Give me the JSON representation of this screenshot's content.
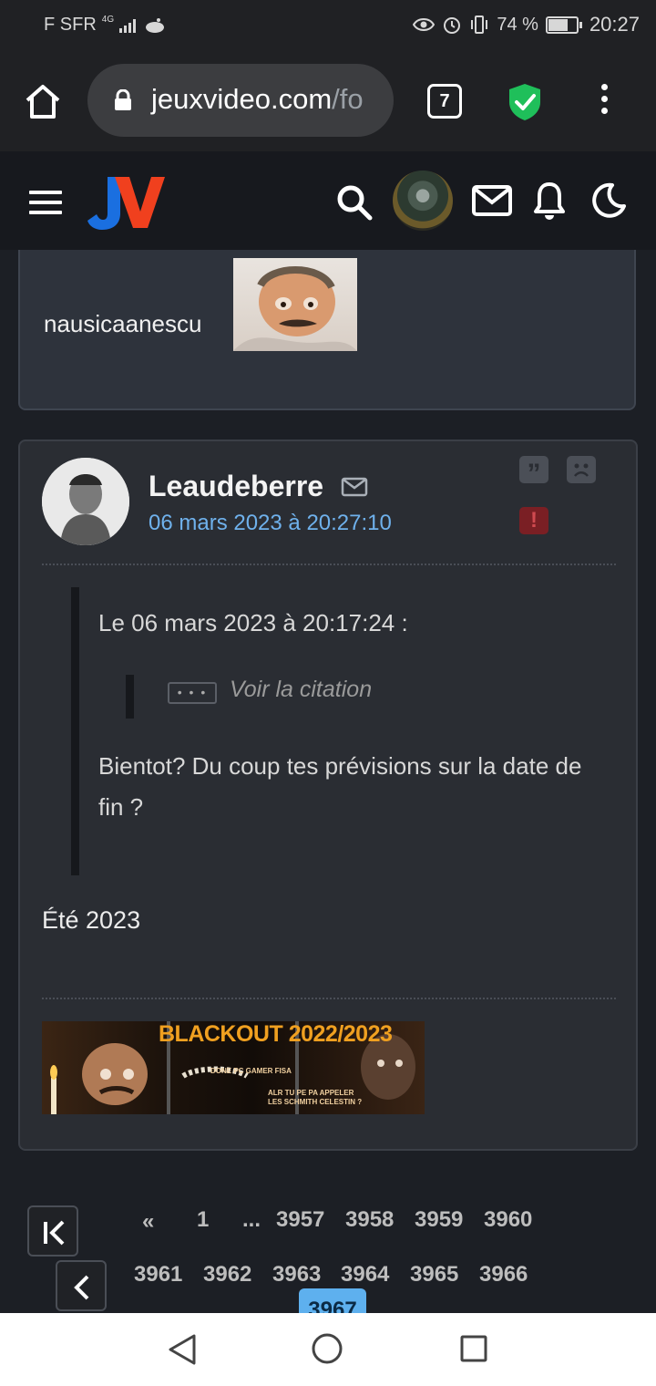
{
  "status_bar": {
    "carrier": "F SFR",
    "network": "4G",
    "battery": "74 %",
    "battery_level": 0.74,
    "time": "20:27"
  },
  "browser": {
    "url_main": "jeuxvideo.com",
    "url_tail": "/fo",
    "tab_count": "7"
  },
  "header": {
    "logo_text": "JV"
  },
  "previous_post": {
    "username": "nausicaanescu"
  },
  "post": {
    "author": "Leaudeberre",
    "date": "06 mars 2023 à 20:27:10",
    "quote": {
      "header": "Le 06 mars 2023 à 20:17:24 :",
      "nested_button": "• • •",
      "nested_label": "Voir la citation",
      "body": "Bientot? Du coup tes prévisions sur la date de fin ?"
    },
    "answer": "Été 2023",
    "signature": {
      "title": "BLACKOUT 2022/2023",
      "line1": "DONE PC GAMER FISA",
      "line2": "ALR TU PE PA APPELER LES SCHMITH CELESTIN ?"
    },
    "action_icons": [
      "quote-icon",
      "sad-face-icon",
      "report-icon"
    ]
  },
  "pagination": {
    "prev": "«",
    "first": "1",
    "ellipsis": "...",
    "row1": [
      "3957",
      "3958",
      "3959",
      "3960"
    ],
    "row2": [
      "3961",
      "3962",
      "3963",
      "3964",
      "3965",
      "3966"
    ],
    "current": "3967"
  },
  "colors": {
    "date_link": "#6fb1ec",
    "current_page": "#5eb0ee",
    "shield": "#1fbf5a"
  }
}
